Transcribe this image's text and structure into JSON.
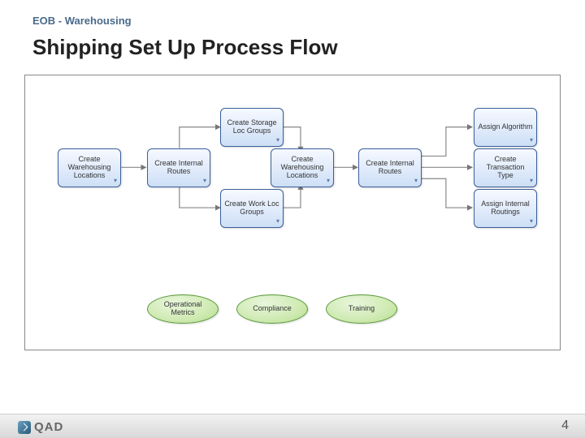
{
  "header": {
    "kicker": "EOB - Warehousing",
    "title": "Shipping Set Up Process Flow"
  },
  "flow": {
    "boxes": {
      "b1": "Create Warehousing Locations",
      "b2": "Create Internal Routes",
      "b3": "Create Storage Loc Groups",
      "b4": "Create Work Loc Groups",
      "b5": "Create Warehousing Locations",
      "b6": "Create Internal Routes",
      "b7": "Assign Algorithm",
      "b8": "Create Transaction Type",
      "b9": "Assign Internal Routings"
    },
    "ellipses": {
      "e1": "Operational Metrics",
      "e2": "Compliance",
      "e3": "Training"
    }
  },
  "footer": {
    "brand": "QAD",
    "page": "4"
  }
}
